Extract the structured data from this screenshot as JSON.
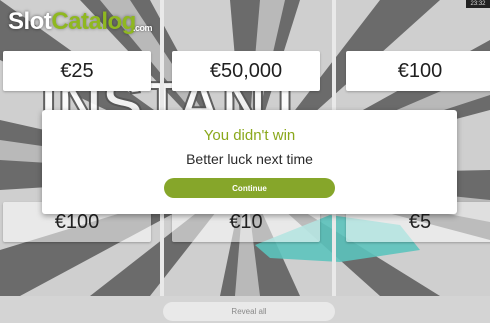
{
  "logo": {
    "part1": "Slot",
    "part2": "Catalog",
    "suffix": ".com"
  },
  "clock": "23:32",
  "tiles": [
    {
      "prize": "€25"
    },
    {
      "prize": "€50,000"
    },
    {
      "prize": "€100"
    },
    {
      "prize": "€100"
    },
    {
      "prize": "€10"
    },
    {
      "prize": "€5"
    }
  ],
  "modal": {
    "title": "You didn't win",
    "subtitle": "Better luck next time",
    "button_label": "Continue"
  },
  "reveal_all_label": "Reveal all",
  "colors": {
    "accent": "#86a62a",
    "title": "#8aa81c",
    "teal": "#5cc3bd"
  }
}
